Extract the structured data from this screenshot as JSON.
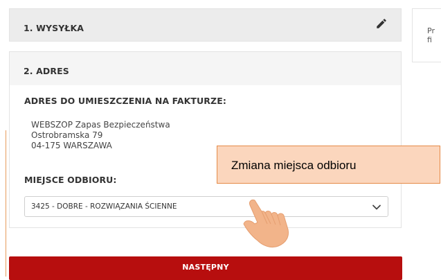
{
  "step1": {
    "title": "1. WYSYŁKA",
    "edit_icon": "pencil-icon"
  },
  "side_panel": {
    "text": "Pr\nfi"
  },
  "step2": {
    "title": "2. ADRES",
    "invoice_label": "ADRES DO UMIESZCZENIA NA FAKTURZE:",
    "address": {
      "line1": "WEBSZOP Zapas Bezpieczeństwa",
      "line2": "Ostrobramska 79",
      "line3": "04-175 WARSZAWA"
    },
    "pickup_label": "MIEJSCE ODBIORU:",
    "pickup_select": {
      "value": "3425 - DOBRE - ROZWIĄZANIA ŚCIENNE",
      "icon": "chevron-down-icon"
    }
  },
  "next_button": {
    "label": "NASTĘPNY"
  },
  "callout": {
    "text": "Zmiana miejsca odbioru"
  },
  "colors": {
    "button_red": "#b70e0e",
    "callout_fill": "#fbd6bd",
    "callout_border": "#e58a47",
    "panel_gray": "#ececec"
  }
}
